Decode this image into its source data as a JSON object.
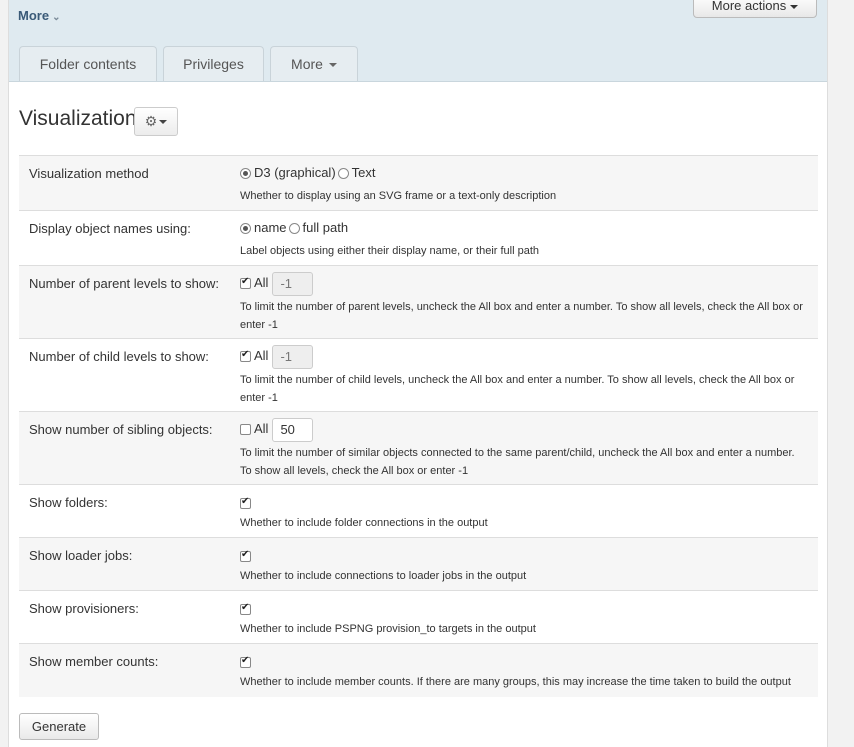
{
  "header": {
    "more_link": "More",
    "more_actions": "More actions"
  },
  "tabs": [
    {
      "label": "Folder contents"
    },
    {
      "label": "Privileges"
    },
    {
      "label": "More"
    }
  ],
  "page_title": "Visualization",
  "form": {
    "method": {
      "label": "Visualization method",
      "options": [
        "D3 (graphical)",
        "Text"
      ],
      "selected": "D3 (graphical)",
      "help": "Whether to display using an SVG frame or a text-only description"
    },
    "names": {
      "label": "Display object names using:",
      "options": [
        "name",
        "full path"
      ],
      "selected": "name",
      "help": "Label objects using either their display name, or their full path"
    },
    "parent_levels": {
      "label": "Number of parent levels to show:",
      "all_label": "All",
      "all_checked": true,
      "value": "-1",
      "help": "To limit the number of parent levels, uncheck the All box and enter a number. To show all levels, check the All box or enter -1"
    },
    "child_levels": {
      "label": "Number of child levels to show:",
      "all_label": "All",
      "all_checked": true,
      "value": "-1",
      "help": "To limit the number of child levels, uncheck the All box and enter a number. To show all levels, check the All box or enter -1"
    },
    "siblings": {
      "label": "Show number of sibling objects:",
      "all_label": "All",
      "all_checked": false,
      "value": "50",
      "help": "To limit the number of similar objects connected to the same parent/child, uncheck the All box and enter a number. To show all levels, check the All box or enter -1"
    },
    "folders": {
      "label": "Show folders:",
      "checked": true,
      "help": "Whether to include folder connections in the output"
    },
    "loader_jobs": {
      "label": "Show loader jobs:",
      "checked": true,
      "help": "Whether to include connections to loader jobs in the output"
    },
    "provisioners": {
      "label": "Show provisioners:",
      "checked": true,
      "help": "Whether to include PSPNG provision_to targets in the output"
    },
    "member_counts": {
      "label": "Show member counts:",
      "checked": true,
      "help": "Whether to include member counts. If there are many groups, this may increase the time taken to build the output"
    }
  },
  "generate_label": "Generate"
}
